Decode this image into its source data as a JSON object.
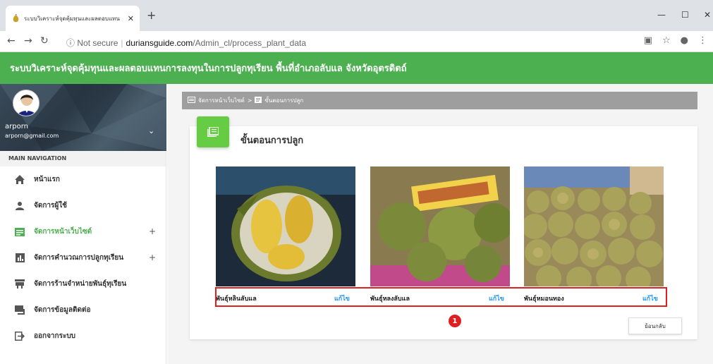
{
  "browser": {
    "tab_title": "ระบบวิเคราะห์จุดคุ้มทุนและผลตอบแทน",
    "url_security": "Not secure",
    "url_domain": "duriansguide.com",
    "url_path": "/Admin_cl/process_plant_data"
  },
  "app": {
    "title": "ระบบวิเคราะห์จุดคุ้มทุนและผลตอบแทนการลงทุนในการปลูกทุเรียน พื้นที่อำเภอลับแล จังหวัดอุตรดิตถ์",
    "brand_color": "#4caf50"
  },
  "user": {
    "name": "arporn",
    "email": "arporn@gmail.com"
  },
  "sidebar": {
    "section_label": "MAIN NAVIGATION",
    "items": [
      {
        "label": "หน้าแรก",
        "icon": "home-icon",
        "expandable": false,
        "active": false
      },
      {
        "label": "จัดการผู้ใช้",
        "icon": "person-icon",
        "expandable": false,
        "active": false
      },
      {
        "label": "จัดการหน้าเว็บไซต์",
        "icon": "web-page-icon",
        "expandable": true,
        "active": true
      },
      {
        "label": "จัดการคำนวณการปลูกทุเรียน",
        "icon": "chart-icon",
        "expandable": true,
        "active": false
      },
      {
        "label": "จัดการร้านจำหน่ายพันธุ์ทุเรียน",
        "icon": "store-icon",
        "expandable": false,
        "active": false
      },
      {
        "label": "จัดการข้อมูลติดต่อ",
        "icon": "contact-icon",
        "expandable": false,
        "active": false
      },
      {
        "label": "ออกจากระบบ",
        "icon": "logout-icon",
        "expandable": false,
        "active": false
      }
    ]
  },
  "breadcrumb": {
    "parent": "จัดการหน้าเว็บไซต์",
    "separator": ">",
    "current": "ขั้นตอนการปลูก"
  },
  "card": {
    "title": "ขั้นตอนการปลูก",
    "edit_label": "แก้ไข",
    "back_label": "ย้อนกลับ",
    "step_number": "1",
    "items": [
      {
        "label": "พันธุ์หลินลับแล",
        "image": "durian-cut-open-photo"
      },
      {
        "label": "พันธุ์หลงลับแล",
        "image": "durian-display-photo"
      },
      {
        "label": "พันธุ์หมอนทอง",
        "image": "durian-pile-photo"
      }
    ]
  }
}
